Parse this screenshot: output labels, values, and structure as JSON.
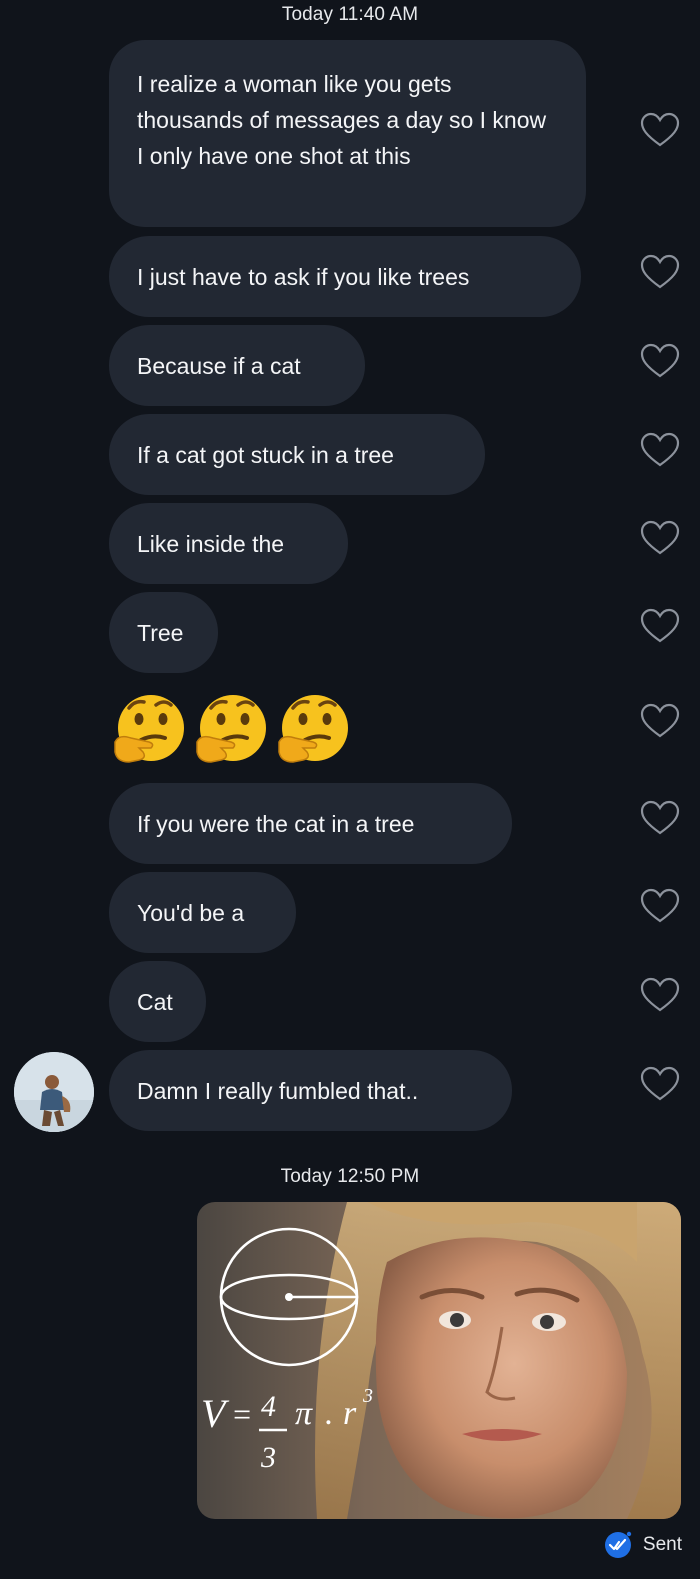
{
  "thread": {
    "timestamp_1": "Today 11:40 AM",
    "messages": [
      {
        "text": "I realize a woman like you gets thousands of messages a day so I know I only have one shot at this"
      },
      {
        "text": "I just have to ask if you like trees"
      },
      {
        "text": "Because if a cat"
      },
      {
        "text": "If a cat got stuck in a tree"
      },
      {
        "text": "Like inside the"
      },
      {
        "text": "Tree"
      },
      {
        "emoji": [
          "thinking-face",
          "thinking-face",
          "thinking-face"
        ]
      },
      {
        "text": "If you were the cat in a tree"
      },
      {
        "text": "You'd be a"
      },
      {
        "text": "Cat"
      },
      {
        "text": "Damn I really fumbled that.."
      }
    ],
    "timestamp_2": "Today 12:50 PM",
    "meme": {
      "formula_v": "V",
      "formula_eq": "=",
      "formula_num": "4",
      "formula_den": "3",
      "formula_pi": "π",
      "formula_dot": ".",
      "formula_r": "r",
      "formula_exp": "3"
    },
    "status": "Sent"
  },
  "colors": {
    "background": "#10141b",
    "bubble": "#222833",
    "accent": "#1f6fe5"
  }
}
